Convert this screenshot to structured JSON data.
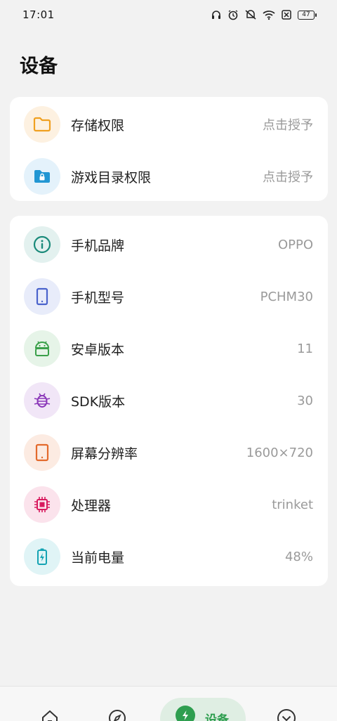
{
  "status_bar": {
    "time": "17:01",
    "battery": "47",
    "icons": [
      "headset-icon",
      "alarm-icon",
      "vibrate-off-icon",
      "wifi-icon",
      "sim-off-icon",
      "battery-icon"
    ]
  },
  "page": {
    "title": "设备"
  },
  "permissions": [
    {
      "label": "存储权限",
      "value": "点击授予",
      "icon": "folder-icon",
      "color": "#f0a020",
      "bg": "#fdf1e1"
    },
    {
      "label": "游戏目录权限",
      "value": "点击授予",
      "icon": "locked-folder-icon",
      "color": "#2196d3",
      "bg": "#e4f2fb"
    }
  ],
  "device_info": [
    {
      "label": "手机品牌",
      "value": "OPPO",
      "icon": "info-icon",
      "color": "#1a8a7a",
      "bg": "#e3f1ef"
    },
    {
      "label": "手机型号",
      "value": "PCHM30",
      "icon": "phone-icon",
      "color": "#4a63cc",
      "bg": "#e8ecfa"
    },
    {
      "label": "安卓版本",
      "value": "11",
      "icon": "android-icon",
      "color": "#3aa04a",
      "bg": "#e6f4e8"
    },
    {
      "label": "SDK版本",
      "value": "30",
      "icon": "bug-icon",
      "color": "#8a36b8",
      "bg": "#f1e6f7"
    },
    {
      "label": "屏幕分辨率",
      "value": "1600×720",
      "icon": "tablet-icon",
      "color": "#e36a2c",
      "bg": "#fcebe2"
    },
    {
      "label": "处理器",
      "value": "trinket",
      "icon": "chip-icon",
      "color": "#d81b5e",
      "bg": "#fbe3ec"
    },
    {
      "label": "当前电量",
      "value": "48%",
      "icon": "battery-charging-icon",
      "color": "#14a3b3",
      "bg": "#e0f4f6"
    }
  ],
  "bottom_nav": {
    "items": [
      {
        "name": "home",
        "icon": "home-icon"
      },
      {
        "name": "discover",
        "icon": "compass-icon"
      },
      {
        "name": "device",
        "icon": "bolt-icon",
        "label": "设备",
        "active": true
      },
      {
        "name": "more",
        "icon": "chevron-circle-icon"
      }
    ],
    "accent": "#2e9e4f"
  }
}
